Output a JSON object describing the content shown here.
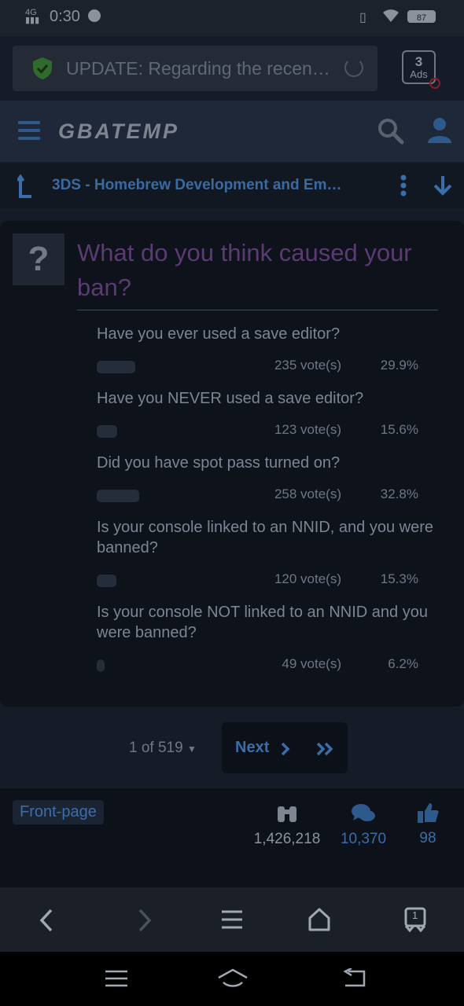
{
  "status_bar": {
    "network": "4G",
    "time": "0:30",
    "battery": "87"
  },
  "browser": {
    "url_text": "UPDATE: Regarding the recen…",
    "ads_count": "3",
    "ads_label": "Ads"
  },
  "site": {
    "logo": "GBATEMP",
    "breadcrumb": "3DS - Homebrew Development and Em…"
  },
  "poll": {
    "icon_glyph": "?",
    "title": "What do you think caused your ban?",
    "options": [
      {
        "question": "Have you ever used a save editor?",
        "votes": "235 vote(s)",
        "percent": "29.9%",
        "fraction": 0.299
      },
      {
        "question": "Have you NEVER used a save editor?",
        "votes": "123 vote(s)",
        "percent": "15.6%",
        "fraction": 0.156
      },
      {
        "question": "Did you have spot pass turned on?",
        "votes": "258 vote(s)",
        "percent": "32.8%",
        "fraction": 0.328
      },
      {
        "question": "Is your console linked to an NNID, and you were banned?",
        "votes": "120 vote(s)",
        "percent": "15.3%",
        "fraction": 0.153
      },
      {
        "question": "Is your console NOT linked to an NNID and you were banned?",
        "votes": "49 vote(s)",
        "percent": "6.2%",
        "fraction": 0.062
      }
    ]
  },
  "pagination": {
    "position": "1 of 519",
    "next_label": "Next"
  },
  "stats": {
    "tag": "Front-page",
    "views": "1,426,218",
    "comments": "10,370",
    "likes": "98"
  },
  "browser_nav": {
    "tabs_count": "1"
  }
}
